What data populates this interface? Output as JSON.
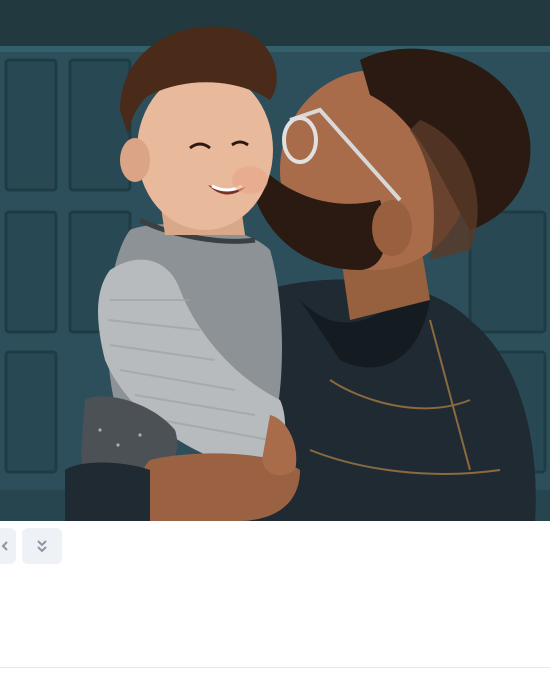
{
  "photo": {
    "subject": "father-kissing-toddler-photo",
    "colors": {
      "background_door": "#2c4f5a",
      "door_panel_shadow": "#24434d",
      "door_panel_light": "#33606c",
      "jacket": "#1f2a33",
      "shirt_gray": "#8d9296",
      "sleeve_stripe": "#b7bbbe",
      "skin_child": "#e9b99c",
      "skin_man": "#a86c4a",
      "hair_dark": "#2a1a12",
      "hair_child": "#4a2a18"
    }
  },
  "toolbar": {
    "left_button_icon": "chevron-left-icon",
    "down_button_icon": "double-chevron-down-icon"
  }
}
